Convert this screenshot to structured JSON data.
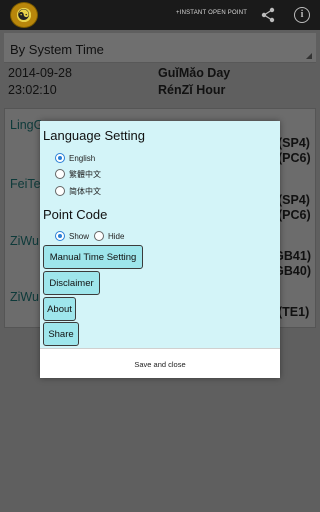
{
  "actionbar": {
    "instant_label": "+INSTANT OPEN POINT",
    "share_icon": "share-icon",
    "info_icon": "info-icon",
    "info_glyph": "i"
  },
  "background": {
    "spinner_value": "By System Time",
    "date": "2014-09-28",
    "day": "GuǐMǎo Day",
    "time": "23:02:10",
    "hour": "RénZǐ Hour",
    "items": [
      {
        "label": "LingGu",
        "code": "(SP4)"
      },
      {
        "label": "",
        "code": "(PC6)"
      },
      {
        "label": "FeiTe",
        "code": "(SP4)"
      },
      {
        "label": "",
        "code": "(PC6)"
      },
      {
        "label": "ZiWu",
        "code": "(GB41)"
      },
      {
        "label": "",
        "code": "(GB40)"
      },
      {
        "label": "ZiWu",
        "code": "(TE1)"
      }
    ]
  },
  "dialog": {
    "language_heading": "Language Setting",
    "languages": [
      "English",
      "繁體中文",
      "简体中文"
    ],
    "selected_language": "English",
    "point_code_heading": "Point Code",
    "point_code_options": [
      "Show",
      "Hide"
    ],
    "selected_point_code": "Show",
    "buttons": {
      "manual_time": "Manual Time Setting",
      "disclaimer": "Disclaimer",
      "about": "About",
      "share": "Share"
    },
    "save_close": "Save and close"
  },
  "colors": {
    "dialog_bg": "#d3f4f8",
    "button_bg": "#9ee6ec",
    "radio_accent": "#2a7fd6",
    "actionbar_bg": "#1a1a1a"
  }
}
